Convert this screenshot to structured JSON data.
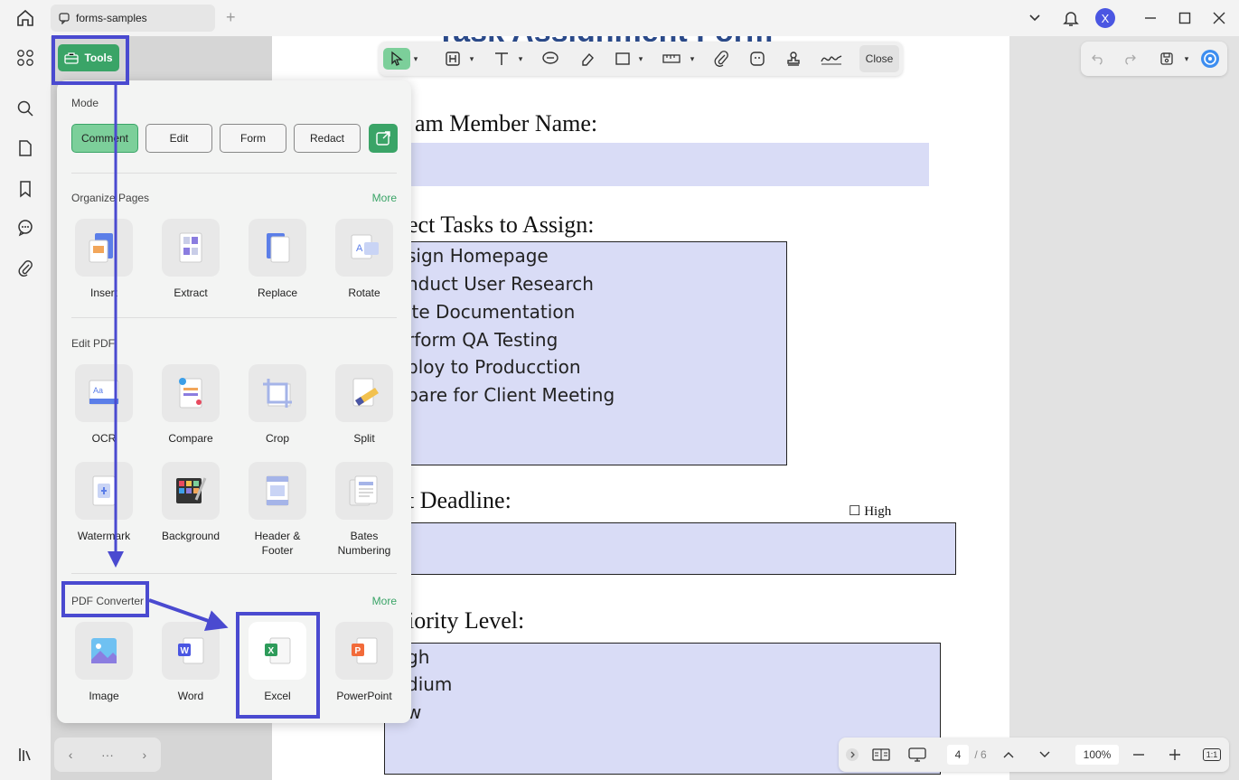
{
  "titlebar": {
    "tab_title": "forms-samples",
    "tab_plus": "+",
    "avatar_letter": "X"
  },
  "toolbar": {
    "close_label": "Close"
  },
  "document": {
    "title_partial": "Task Assignment Form",
    "labels": {
      "member_name": "am Member Name:",
      "tasks": "ect Tasks to Assign:",
      "deadline": "t Deadline:",
      "priority": "iority Level:"
    },
    "tasks": [
      "sign Homepage",
      "nduct User Research",
      "ite Documentation",
      "rform QA Testing",
      "ploy to Producction",
      "pare for Client Meeting"
    ],
    "priority_options": [
      "gh",
      "dium",
      "w"
    ],
    "high_checkbox": "☐ High"
  },
  "pagebar": {
    "current_page": "4",
    "total_pages": "/ 6",
    "zoom": "100%",
    "fit_label": "1:1"
  },
  "sidebar_bottom": {
    "dots": "···"
  },
  "tools_popup": {
    "button_label": "Tools",
    "mode_title": "Mode",
    "modes": [
      "Comment",
      "Edit",
      "Form",
      "Redact"
    ],
    "organize_title": "Organize Pages",
    "organize_more": "More",
    "organize_tools": [
      "Insert",
      "Extract",
      "Replace",
      "Rotate"
    ],
    "edit_title": "Edit PDF",
    "edit_tools_row1": [
      "OCR",
      "Compare",
      "Crop",
      "Split"
    ],
    "edit_tools_row2": [
      "Watermark",
      "Background",
      "Header & Footer",
      "Bates Numbering"
    ],
    "converter_title": "PDF Converter",
    "converter_more": "More",
    "converter_tools": [
      "Image",
      "Word",
      "Excel",
      "PowerPoint"
    ]
  },
  "colors": {
    "accent_green": "#3aa467",
    "annotation_blue": "#4a4ad0",
    "field_fill": "#d9dcf6"
  }
}
